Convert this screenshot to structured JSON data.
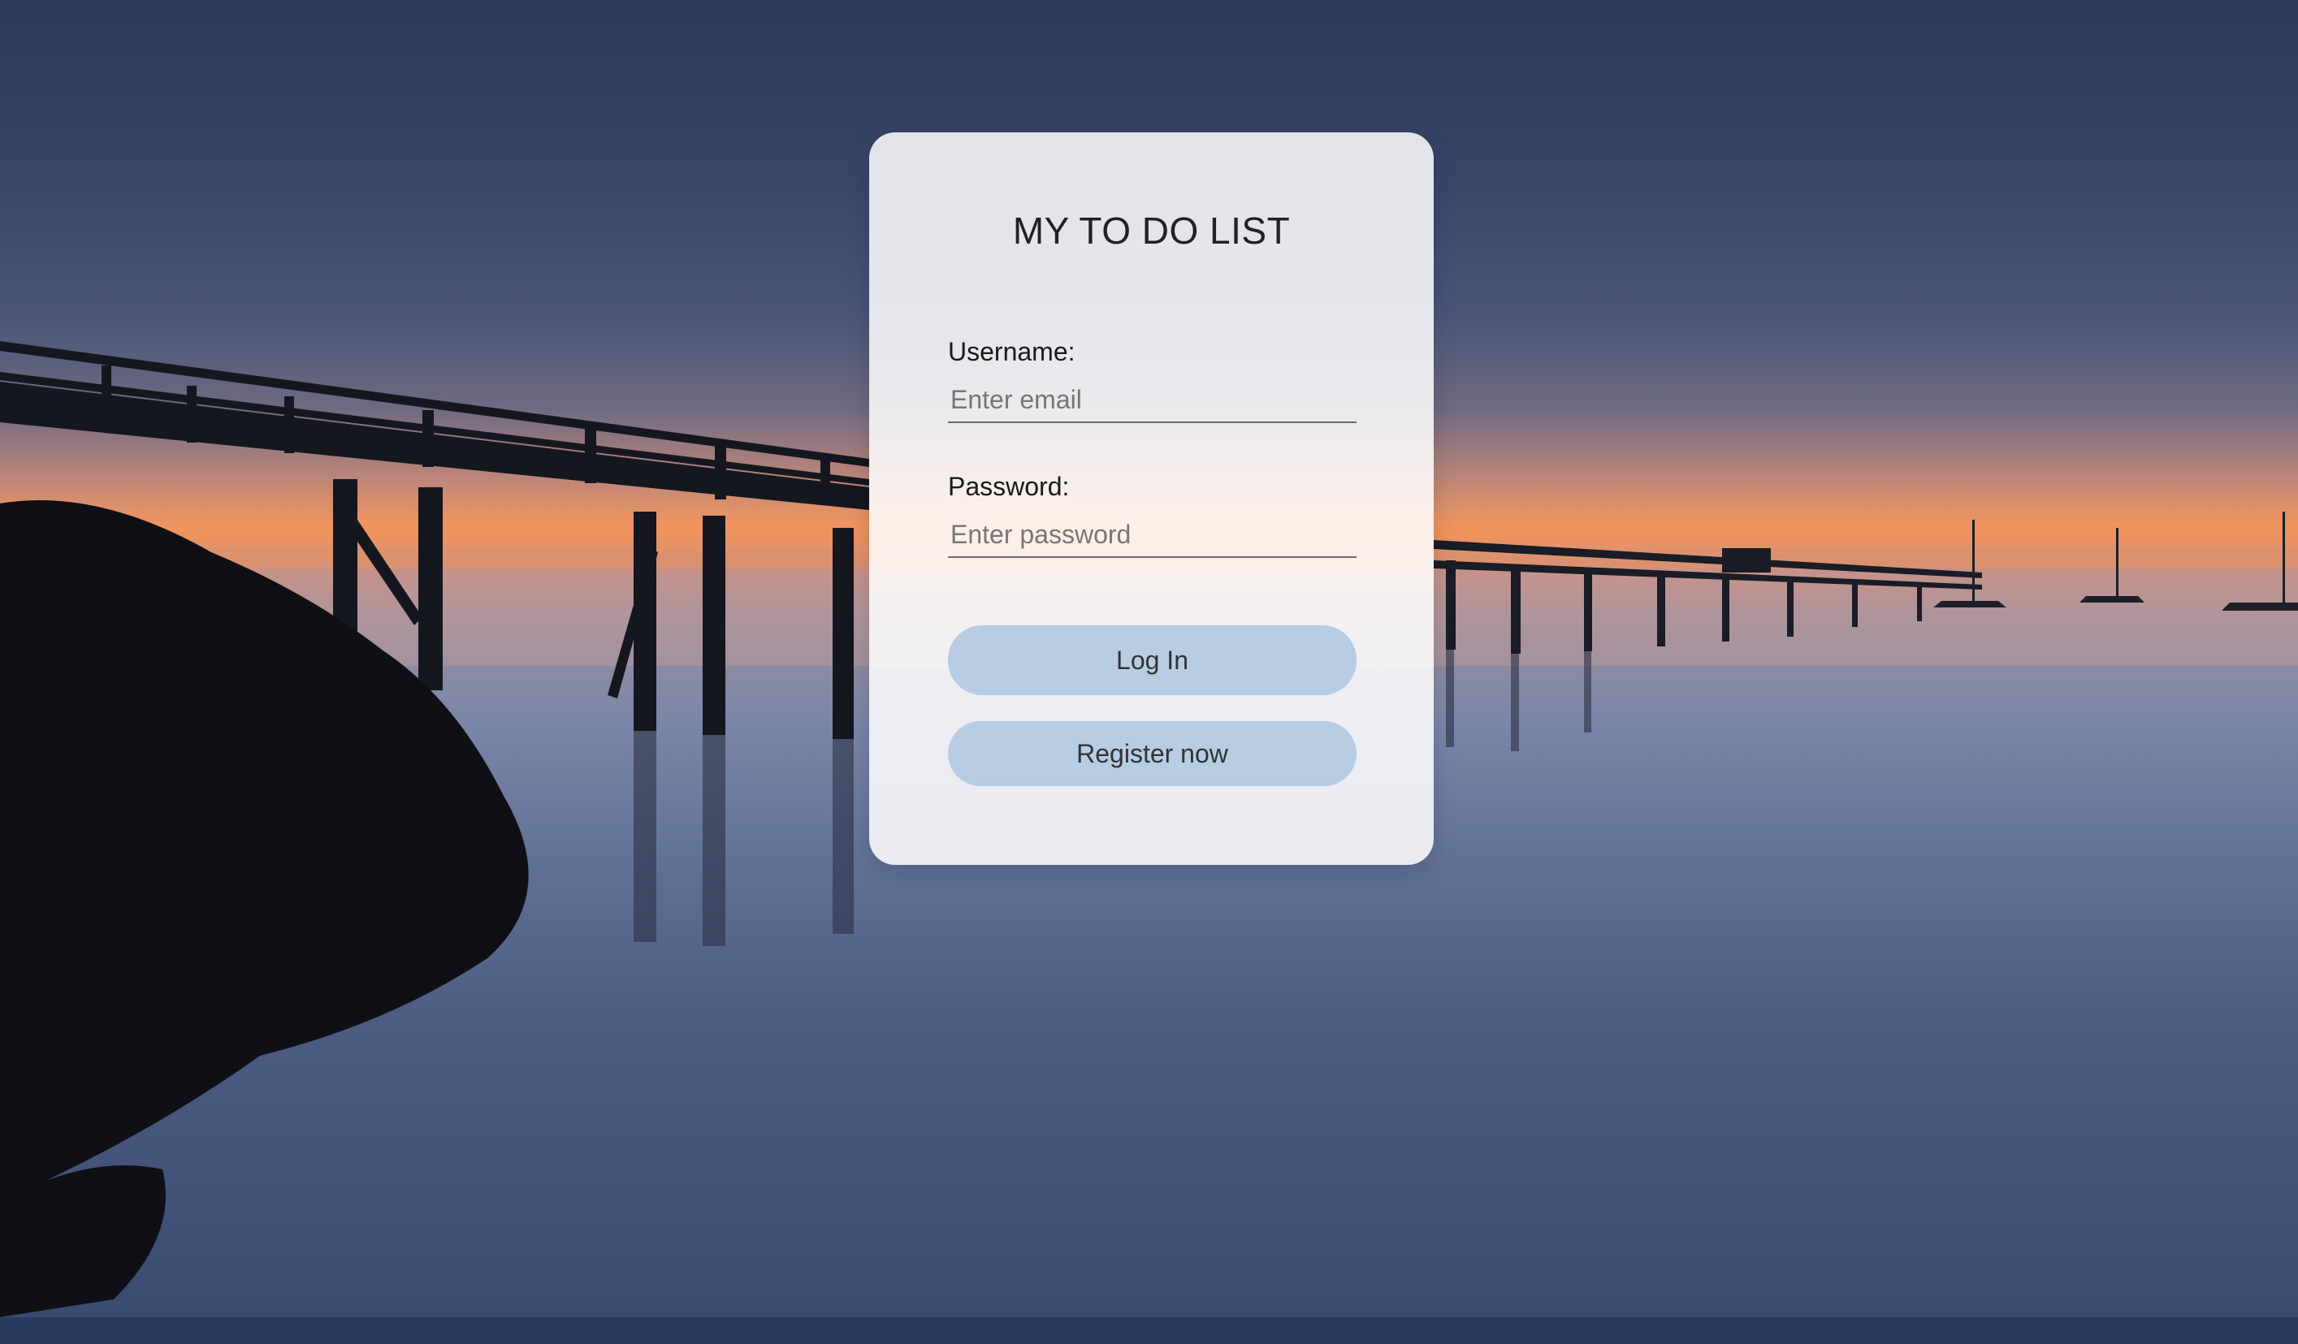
{
  "app": {
    "title": "MY TO DO LIST"
  },
  "login_form": {
    "username": {
      "label": "Username:",
      "placeholder": "Enter email",
      "value": ""
    },
    "password": {
      "label": "Password:",
      "placeholder": "Enter password",
      "value": ""
    },
    "login_button_label": "Log In",
    "register_button_label": "Register now"
  },
  "colors": {
    "card_background": "#f4f4f6",
    "button_background": "#b0c9e1",
    "text": "#222222",
    "footer_bar": "#283a5e"
  }
}
